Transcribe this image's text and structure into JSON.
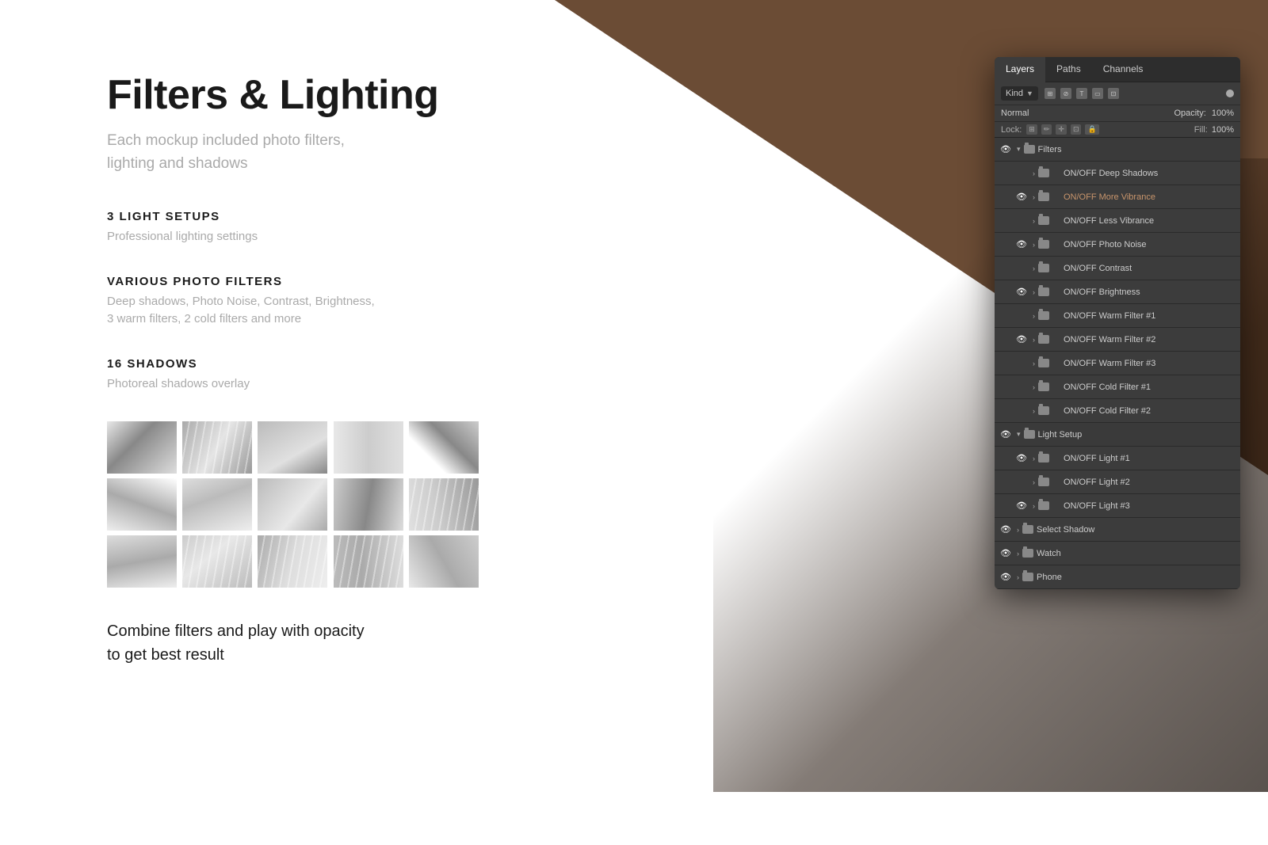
{
  "background": {
    "triangle_color": "#6b4c35"
  },
  "hero": {
    "title": "Filters & Lighting",
    "subtitle_line1": "Each mockup included photo filters,",
    "subtitle_line2": "lighting and shadows"
  },
  "sections": [
    {
      "id": "light-setups",
      "title": "3 LIGHT SETUPS",
      "description": "Professional lighting settings"
    },
    {
      "id": "photo-filters",
      "title": "VARIOUS PHOTO FILTERS",
      "description": "Deep shadows, Photo Noise, Contrast, Brightness,\n3 warm filters, 2 cold filters and more"
    },
    {
      "id": "shadows",
      "title": "16 SHADOWS",
      "description": "Photoreal shadows overlay"
    }
  ],
  "bottom_text": {
    "line1": "Combine filters and play with opacity",
    "line2": "to get best result"
  },
  "ps_panel": {
    "tabs": [
      "Layers",
      "Paths",
      "Channels"
    ],
    "active_tab": "Layers",
    "toolbar": {
      "kind_label": "Kind",
      "dot_color": "#aaa"
    },
    "mode_label": "Normal",
    "opacity_label": "Opacity:",
    "lock_label": "Lock:",
    "fill_label": "Fill:",
    "layers": [
      {
        "id": "filters-group",
        "visible": true,
        "indent": 0,
        "is_group": true,
        "expanded": true,
        "name": "Filters"
      },
      {
        "id": "deep-shadows",
        "visible": false,
        "indent": 1,
        "is_group": true,
        "name": "ON/OFF Deep Shadows"
      },
      {
        "id": "more-vibrance",
        "visible": true,
        "indent": 1,
        "is_group": true,
        "name": "ON/OFF More Vibrance",
        "vibrance": true
      },
      {
        "id": "less-vibrance",
        "visible": false,
        "indent": 1,
        "is_group": true,
        "name": "ON/OFF Less Vibrance"
      },
      {
        "id": "photo-noise",
        "visible": true,
        "indent": 1,
        "is_group": true,
        "name": "ON/OFF Photo Noise"
      },
      {
        "id": "contrast",
        "visible": false,
        "indent": 1,
        "is_group": true,
        "name": "ON/OFF Contrast"
      },
      {
        "id": "brightness",
        "visible": true,
        "indent": 1,
        "is_group": true,
        "name": "ON/OFF Brightness"
      },
      {
        "id": "warm-filter-1",
        "visible": false,
        "indent": 1,
        "is_group": true,
        "name": "ON/OFF Warm Filter #1"
      },
      {
        "id": "warm-filter-2",
        "visible": true,
        "indent": 1,
        "is_group": true,
        "name": "ON/OFF Warm Filter #2"
      },
      {
        "id": "warm-filter-3",
        "visible": false,
        "indent": 1,
        "is_group": true,
        "name": "ON/OFF Warm Filter #3"
      },
      {
        "id": "cold-filter-1",
        "visible": false,
        "indent": 1,
        "is_group": true,
        "name": "ON/OFF Cold Filter #1"
      },
      {
        "id": "cold-filter-2",
        "visible": false,
        "indent": 1,
        "is_group": true,
        "name": "ON/OFF Cold Filter #2"
      },
      {
        "id": "light-setup-group",
        "visible": true,
        "indent": 0,
        "is_group": true,
        "expanded": true,
        "name": "Light Setup"
      },
      {
        "id": "light-1",
        "visible": true,
        "indent": 1,
        "is_group": true,
        "name": "ON/OFF Light #1"
      },
      {
        "id": "light-2",
        "visible": false,
        "indent": 1,
        "is_group": true,
        "name": "ON/OFF Light #2"
      },
      {
        "id": "light-3",
        "visible": true,
        "indent": 1,
        "is_group": true,
        "name": "ON/OFF Light #3"
      },
      {
        "id": "select-shadow",
        "visible": true,
        "indent": 0,
        "is_group": true,
        "name": "Select Shadow"
      },
      {
        "id": "watch",
        "visible": true,
        "indent": 0,
        "is_group": true,
        "name": "Watch"
      },
      {
        "id": "phone",
        "visible": true,
        "indent": 0,
        "is_group": true,
        "name": "Phone"
      }
    ]
  },
  "shadow_thumbs": [
    "t1",
    "t2",
    "t3",
    "t4",
    "t5",
    "t6",
    "t7",
    "t8",
    "t9",
    "t10",
    "t11",
    "t12",
    "t13",
    "t14",
    "t15"
  ]
}
